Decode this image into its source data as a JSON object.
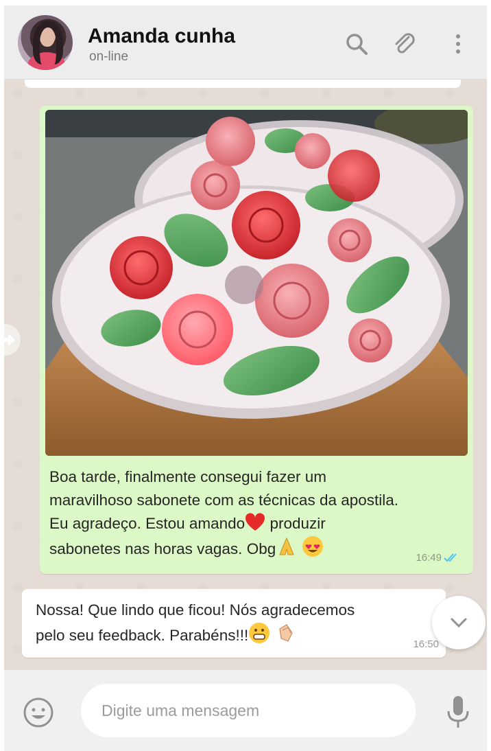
{
  "header": {
    "contact_name": "Amanda cunha",
    "status": "on-line",
    "icons": [
      "search-icon",
      "paperclip-icon",
      "menu-icon"
    ]
  },
  "messages": {
    "outgoing": {
      "line1": "Boa tarde, finalmente consegui fazer um",
      "line2": "maravilhoso sabonete com as técnicas da apostila.",
      "line3a": "Eu agradeço. Estou amando",
      "line3b": " produzir",
      "line4": "sabonetes nas horas vagas. Obg",
      "emojis": [
        "heart",
        "folded-hands",
        "heart-eyes"
      ],
      "time": "16:49",
      "status": "read"
    },
    "incoming": {
      "line1": "Nossa! Que lindo que ficou! Nós agradecemos",
      "line2": "pelo seu feedback. Parabéns!!!",
      "emojis": [
        "grinning-face",
        "clapping-hands"
      ],
      "time": "16:50"
    }
  },
  "composer": {
    "placeholder": "Digite uma mensagem"
  },
  "colors": {
    "outgoing_bubble": "#dcf8c6",
    "incoming_bubble": "#ffffff",
    "chat_bg": "#e5ddd5",
    "read_ticks": "#4fc3f7"
  }
}
